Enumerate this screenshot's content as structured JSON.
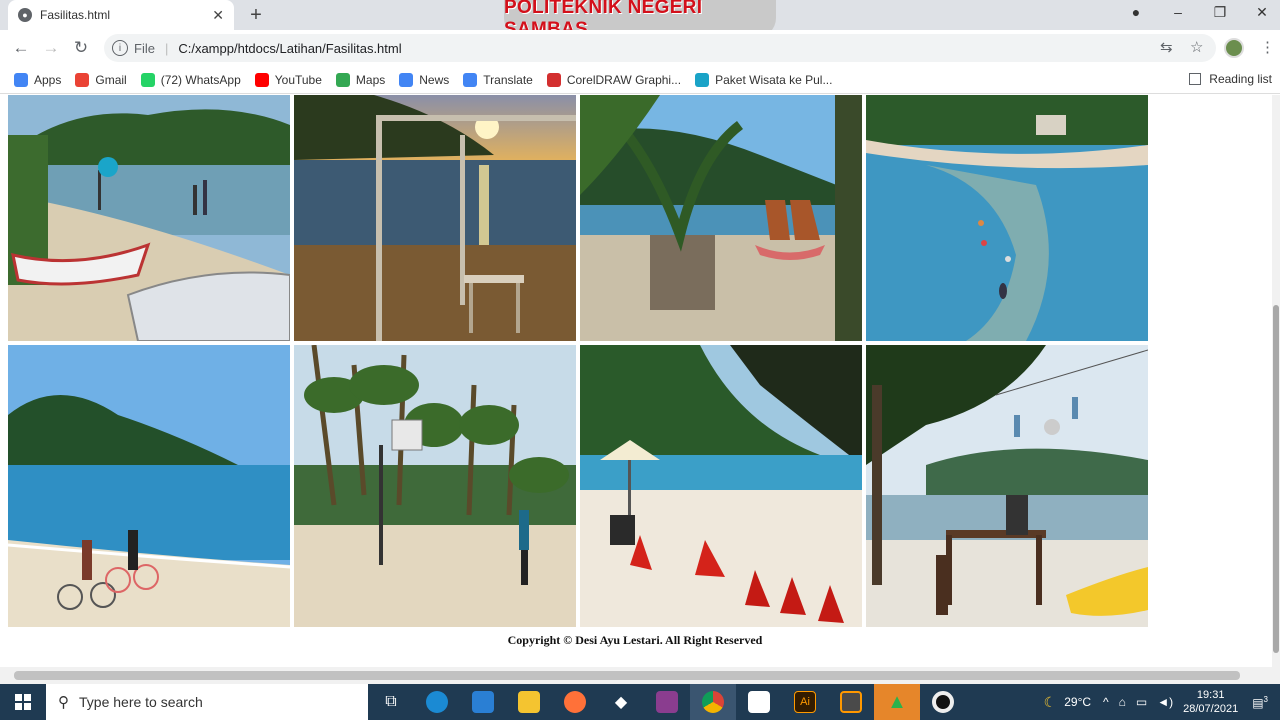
{
  "browser": {
    "tab_title": "Fasilitas.html",
    "url_scheme": "File",
    "url": "C:/xampp/htdocs/Latihan/Fasilitas.html",
    "watermark": "POLITEKNIK NEGERI SAMBAS"
  },
  "bookmarks": [
    {
      "label": "Apps",
      "color": "#4285f4"
    },
    {
      "label": "Gmail",
      "color": "#ea4335"
    },
    {
      "label": "(72) WhatsApp",
      "color": "#25d366"
    },
    {
      "label": "YouTube",
      "color": "#ff0000"
    },
    {
      "label": "Maps",
      "color": "#34a853"
    },
    {
      "label": "News",
      "color": "#4285f4"
    },
    {
      "label": "Translate",
      "color": "#4285f4"
    },
    {
      "label": "CorelDRAW Graphi...",
      "color": "#d32f2f"
    },
    {
      "label": "Paket Wisata ke Pul...",
      "color": "#1aa3c7"
    }
  ],
  "reading_list": "Reading list",
  "gallery": {
    "photos": [
      {
        "name": "beach-boats"
      },
      {
        "name": "beach-sunset"
      },
      {
        "name": "beach-chairs"
      },
      {
        "name": "aerial-lagoon"
      },
      {
        "name": "beach-bicycles"
      },
      {
        "name": "beach-basketball"
      },
      {
        "name": "beach-beanbags"
      },
      {
        "name": "beach-cafe"
      }
    ],
    "copyright": "Copyright © Desi Ayu Lestari. All Right Reserved"
  },
  "taskbar": {
    "search_placeholder": "Type here to search",
    "weather": "29°C",
    "time": "19:31",
    "date": "28/07/2021",
    "notifications": "3"
  }
}
